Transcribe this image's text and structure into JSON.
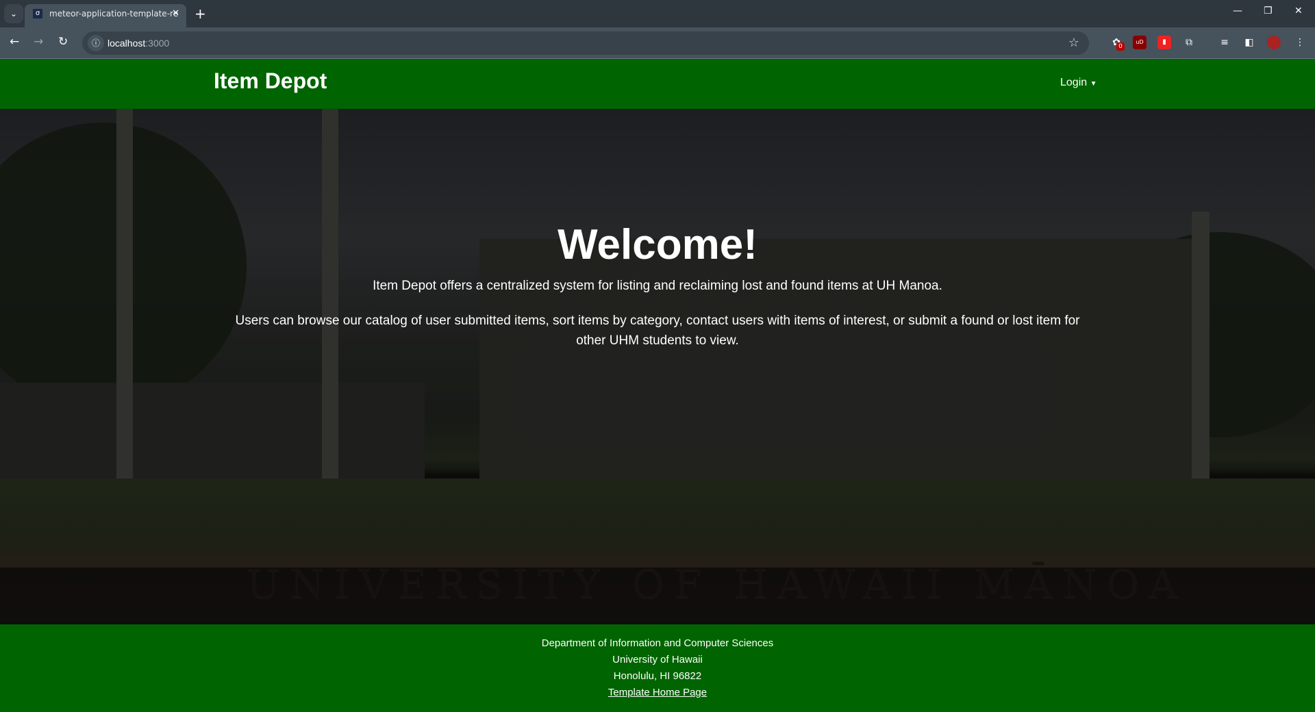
{
  "browser": {
    "tab_title": "meteor-application-template-re",
    "url_host": "localhost",
    "url_port": ":3000",
    "extension_badge": "0",
    "ext_ublock_label": "uD"
  },
  "navbar": {
    "brand": "Item Depot",
    "login_label": "Login"
  },
  "hero": {
    "heading": "Welcome!",
    "paragraph1": "Item Depot offers a centralized system for listing and reclaiming lost and found items at UH Manoa.",
    "paragraph2": "Users can browse our catalog of user submitted items, sort items by category, contact users with items of interest, or submit a found or lost item for other UHM students to view.",
    "sign_text": "UNIVERSITY OF HAWAII MĀNOA"
  },
  "footer": {
    "line1": "Department of Information and Computer Sciences",
    "line2": "University of Hawaii",
    "line3": "Honolulu, HI 96822",
    "link": "Template Home Page"
  },
  "colors": {
    "brand_green": "#006400"
  }
}
